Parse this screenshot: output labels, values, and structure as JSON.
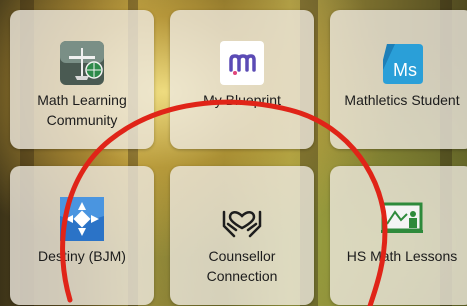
{
  "tiles": [
    {
      "label": "Math Learning\nCommunity",
      "icon": "math-learning-community-icon"
    },
    {
      "label": "My Blueprint",
      "icon": "myblueprint-icon"
    },
    {
      "label": "Mathletics Student",
      "icon": "mathletics-icon",
      "icon_text": "Ms"
    },
    {
      "label": "Destiny (BJM)",
      "icon": "destiny-icon"
    },
    {
      "label": "Counsellor\nConnection",
      "icon": "heart-hands-icon"
    },
    {
      "label": "HS Math Lessons",
      "icon": "chalkboard-icon"
    }
  ],
  "colors": {
    "annotation": "#e02418",
    "tile_bg": "rgba(238,232,222,0.80)",
    "mathletics_blue": "#2a9fd8",
    "destiny_blue": "#2b73c7",
    "chalkboard_green": "#2e8a3b",
    "blueprint_purple": "#5b4bb5"
  }
}
